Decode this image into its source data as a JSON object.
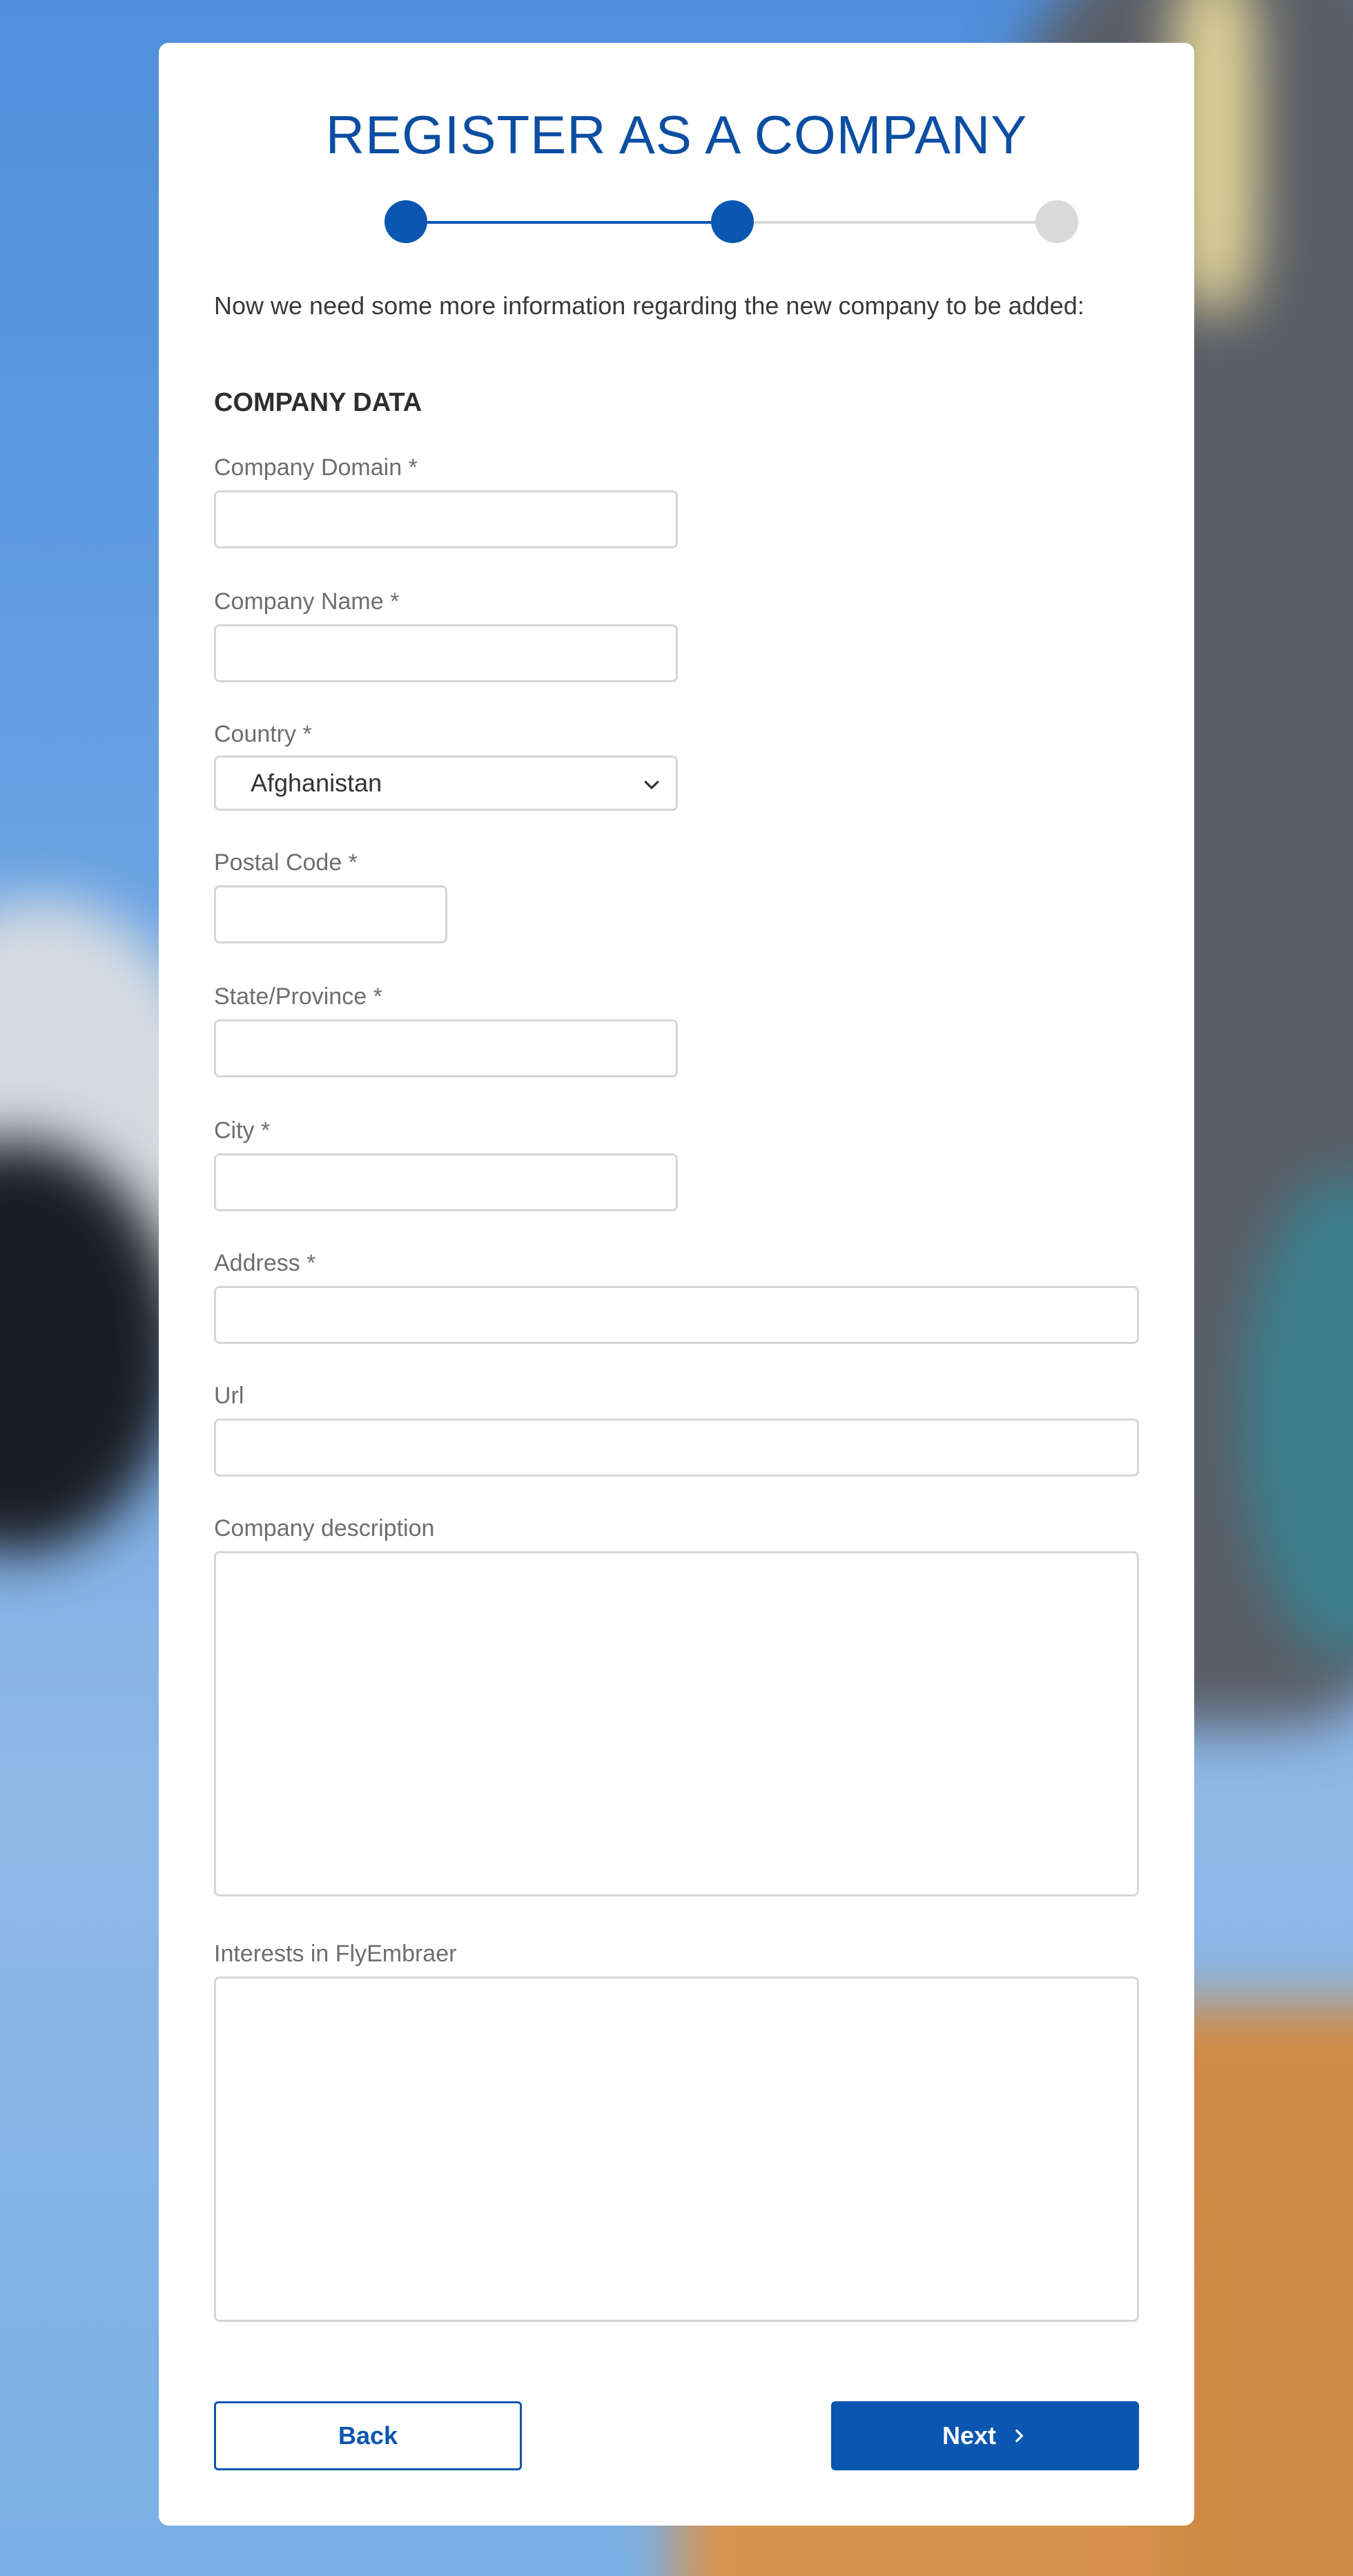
{
  "page": {
    "title": "REGISTER AS A COMPANY",
    "intro": "Now we need some more information regarding the new company to be added:",
    "stepper": {
      "total_steps": 3,
      "current_step": 2
    },
    "colors": {
      "primary": "#0a56b0",
      "title": "#0b4ea2",
      "step_inactive": "#d9d9d9",
      "border": "#d6d6d6"
    }
  },
  "section": {
    "title": "COMPANY DATA"
  },
  "fields": {
    "company_domain": {
      "label": "Company Domain *",
      "value": ""
    },
    "company_name": {
      "label": "Company Name *",
      "value": ""
    },
    "country": {
      "label": "Country *",
      "value": "Afghanistan"
    },
    "postal_code": {
      "label": "Postal Code *",
      "value": ""
    },
    "state": {
      "label": "State/Province *",
      "value": ""
    },
    "city": {
      "label": "City *",
      "value": ""
    },
    "address": {
      "label": "Address *",
      "value": ""
    },
    "url": {
      "label": "Url",
      "value": ""
    },
    "description": {
      "label": "Company description",
      "value": ""
    },
    "interests": {
      "label": "Interests in FlyEmbraer",
      "value": ""
    }
  },
  "buttons": {
    "back": "Back",
    "next": "Next",
    "next_icon": "chevron-right-icon",
    "select_icon": "chevron-down-icon"
  }
}
